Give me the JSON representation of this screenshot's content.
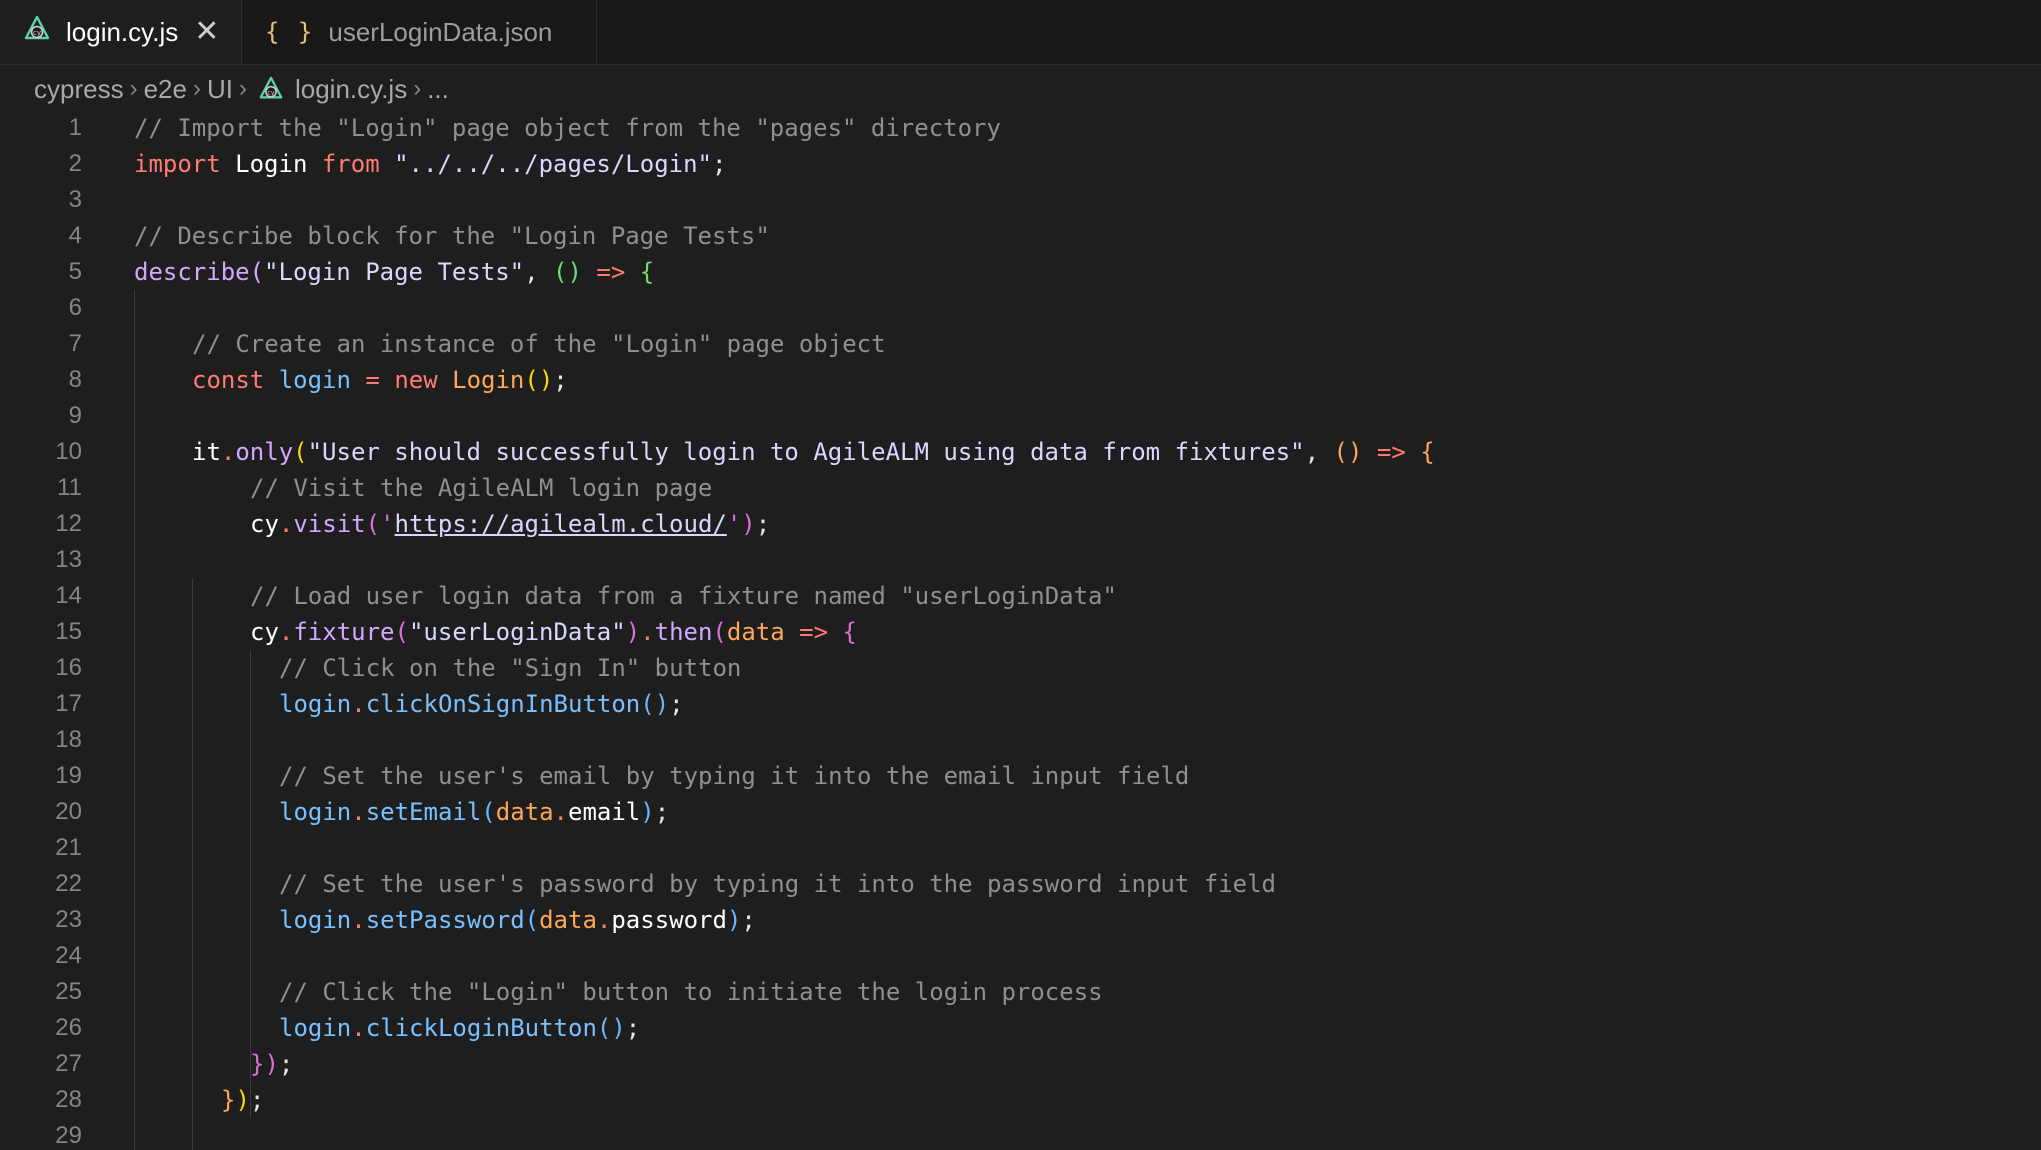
{
  "tabs": [
    {
      "label": "login.cy.js",
      "icon": "cypress-icon",
      "active": true
    },
    {
      "label": "userLoginData.json",
      "icon": "json-braces-icon",
      "active": false
    }
  ],
  "json_icon_glyph": "{ }",
  "close_glyph": "✕",
  "breadcrumb": {
    "items": [
      "cypress",
      "e2e",
      "UI",
      "login.cy.js",
      "..."
    ],
    "separator": "›"
  },
  "line_numbers": [
    "1",
    "2",
    "3",
    "4",
    "5",
    "6",
    "7",
    "8",
    "9",
    "10",
    "11",
    "12",
    "13",
    "14",
    "15",
    "16",
    "17",
    "18",
    "19",
    "20",
    "21",
    "22",
    "23",
    "24",
    "25",
    "26",
    "27",
    "28",
    "29"
  ],
  "code": {
    "l1_comment": "// Import the \"Login\" page object from the \"pages\" directory",
    "l2_import": "import",
    "l2_name": " Login ",
    "l2_from": "from",
    "l2_path": " \"../../../pages/Login\"",
    "l2_semi": ";",
    "l4_comment": "// Describe block for the \"Login Page Tests\"",
    "l5_describe": "describe",
    "l5_paren": "(",
    "l5_str": "\"Login Page Tests\"",
    "l5_comma": ", ",
    "l5_args": "()",
    "l5_arrow": " => ",
    "l5_brace": "{",
    "l7_comment": "// Create an instance of the \"Login\" page object",
    "l8_const": "const",
    "l8_var": " login ",
    "l8_eq": "= ",
    "l8_new": "new",
    "l8_cls": " Login",
    "l8_parens": "()",
    "l8_semi": ";",
    "l10_it": "it",
    "l10_dot": ".",
    "l10_only": "only",
    "l10_paren": "(",
    "l10_str": "\"User should successfully login to AgileALM using data from fixtures\"",
    "l10_comma": ", ",
    "l10_args": "()",
    "l10_arrow": " => ",
    "l10_brace": "{",
    "l11_comment": "// Visit the AgileALM login page",
    "l12_cy": "cy",
    "l12_dot": ".",
    "l12_visit": "visit",
    "l12_open": "('",
    "l12_url": "https://agilealm.cloud/",
    "l12_close": "')",
    "l12_semi": ";",
    "l14_comment": "// Load user login data from a fixture named \"userLoginData\"",
    "l15_cy": "cy",
    "l15_dot": ".",
    "l15_fixture": "fixture",
    "l15_open": "(",
    "l15_str": "\"userLoginData\"",
    "l15_close": ")",
    "l15_dot2": ".",
    "l15_then": "then",
    "l15_open2": "(",
    "l15_data": "data",
    "l15_arrow": " => ",
    "l15_brace": "{",
    "l16_comment": "// Click on the \"Sign In\" button",
    "l17_login": "login",
    "l17_dot": ".",
    "l17_method": "clickOnSignInButton",
    "l17_parens": "()",
    "l17_semi": ";",
    "l19_comment": "// Set the user's email by typing it into the email input field",
    "l20_login": "login",
    "l20_dot": ".",
    "l20_method": "setEmail",
    "l20_open": "(",
    "l20_data": "data",
    "l20_dot2": ".",
    "l20_prop": "email",
    "l20_close": ")",
    "l20_semi": ";",
    "l22_comment": "// Set the user's password by typing it into the password input field",
    "l23_login": "login",
    "l23_dot": ".",
    "l23_method": "setPassword",
    "l23_open": "(",
    "l23_data": "data",
    "l23_dot2": ".",
    "l23_prop": "password",
    "l23_close": ")",
    "l23_semi": ";",
    "l25_comment": "// Click the \"Login\" button to initiate the login process",
    "l26_login": "login",
    "l26_dot": ".",
    "l26_method": "clickLoginButton",
    "l26_parens": "()",
    "l26_semi": ";",
    "l27_brace": "}",
    "l27_paren": ")",
    "l27_semi": ";",
    "l28_brace": "}",
    "l28_paren": ")",
    "l28_semi": ";"
  },
  "colors": {
    "background": "#1e1e1e",
    "comment": "#8f8f8f",
    "keyword": "#ff7b72",
    "string": "#d8d8ff",
    "function": "#d2a8ff",
    "variable": "#79c0ff",
    "parameter": "#ffa657",
    "line_number": "#858585"
  }
}
